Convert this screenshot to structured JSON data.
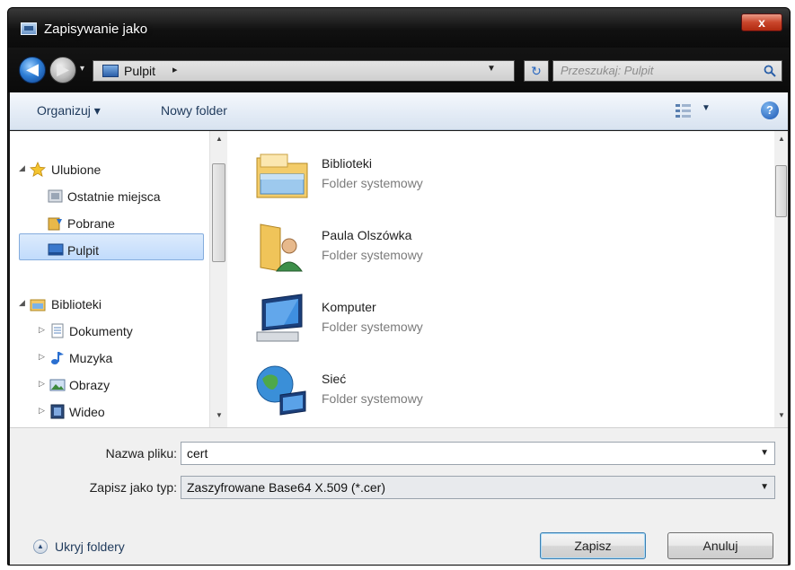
{
  "window": {
    "title": "Zapisywanie jako",
    "close_label": "x"
  },
  "address_bar": {
    "back_glyph": "◀",
    "forward_glyph": "▶",
    "path": "Pulpit",
    "path_separator": "▸",
    "search_placeholder": "Przeszukaj: Pulpit"
  },
  "toolbar": {
    "organize": "Organizuj ▾",
    "new_folder": "Nowy folder",
    "help": "?"
  },
  "nav": {
    "favorites": "Ulubione",
    "recent": "Ostatnie miejsca",
    "downloads": "Pobrane",
    "desktop": "Pulpit",
    "libraries": "Biblioteki",
    "documents": "Dokumenty",
    "music": "Muzyka",
    "pictures": "Obrazy",
    "videos": "Wideo"
  },
  "files": [
    {
      "name": "Biblioteki",
      "type": "Folder systemowy",
      "icon": "libraries-folder-icon"
    },
    {
      "name": "Paula Olszówka",
      "type": "Folder systemowy",
      "icon": "user-folder-icon"
    },
    {
      "name": "Komputer",
      "type": "Folder systemowy",
      "icon": "computer-icon"
    },
    {
      "name": "Sieć",
      "type": "Folder systemowy",
      "icon": "network-icon"
    }
  ],
  "form": {
    "filename_label": "Nazwa pliku:",
    "filename_value": "cert",
    "filetype_label": "Zapisz jako typ:",
    "filetype_value": "Zaszyfrowane Base64 X.509 (*.cer)"
  },
  "footer": {
    "hide_folders": "Ukryj foldery",
    "save": "Zapisz",
    "cancel": "Anuluj"
  },
  "colors": {
    "selection": "#c1dbfc",
    "toolbar_text": "#1e395b",
    "close_button": "#c9452b"
  }
}
